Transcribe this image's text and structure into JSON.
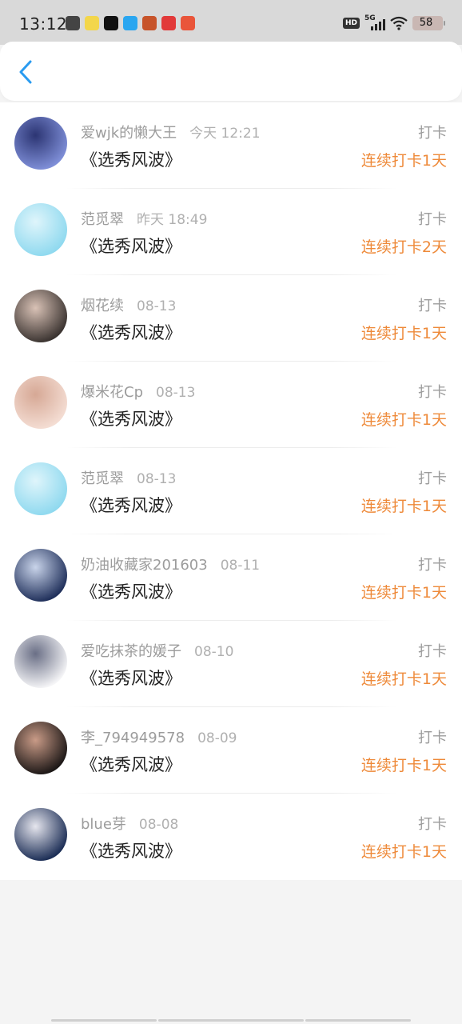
{
  "status_bar": {
    "time": "13:12",
    "network": "5G",
    "hd": "HD",
    "battery": "58",
    "notification_icons": [
      {
        "name": "app-icon-1",
        "color": "#444444"
      },
      {
        "name": "app-icon-2",
        "color": "#f3d64b"
      },
      {
        "name": "tiktok-icon",
        "color": "#111111"
      },
      {
        "name": "app-icon-4",
        "color": "#2aa6f0"
      },
      {
        "name": "app-icon-5",
        "color": "#c7542a"
      },
      {
        "name": "app-icon-6",
        "color": "#e23a3a"
      },
      {
        "name": "app-icon-7",
        "color": "#e9553a"
      }
    ]
  },
  "nav": {
    "back_icon": "chevron-left-icon",
    "accent": "#2a9bf0"
  },
  "colors": {
    "streak": "#ee8a3a",
    "meta": "#9c9c9c"
  },
  "items": [
    {
      "name": "爱wjk的懒大王",
      "time": "今天 12:21",
      "title": "《选秀风波》",
      "action": "打卡",
      "streak": "连续打卡1天",
      "avatar_colors": [
        "#7f8fd8",
        "#2c3573"
      ]
    },
    {
      "name": "范觅翠",
      "time": "昨天 18:49",
      "title": "《选秀风波》",
      "action": "打卡",
      "streak": "连续打卡2天",
      "avatar_colors": [
        "#8fd9ef",
        "#dff5fb"
      ]
    },
    {
      "name": "烟花续",
      "time": "08-13",
      "title": "《选秀风波》",
      "action": "打卡",
      "streak": "连续打卡1天",
      "avatar_colors": [
        "#3a3330",
        "#d9c2b6"
      ]
    },
    {
      "name": "爆米花Cp",
      "time": "08-13",
      "title": "《选秀风波》",
      "action": "打卡",
      "streak": "连续打卡1天",
      "avatar_colors": [
        "#f4ddd3",
        "#d6a895"
      ]
    },
    {
      "name": "范觅翠",
      "time": "08-13",
      "title": "《选秀风波》",
      "action": "打卡",
      "streak": "连续打卡1天",
      "avatar_colors": [
        "#8fd9ef",
        "#dff5fb"
      ]
    },
    {
      "name": "奶油收藏家201603",
      "time": "08-11",
      "title": "《选秀风波》",
      "action": "打卡",
      "streak": "连续打卡1天",
      "avatar_colors": [
        "#1f2f5a",
        "#c9d4ea"
      ]
    },
    {
      "name": "爱吃抹茶的媛子",
      "time": "08-10",
      "title": "《选秀风波》",
      "action": "打卡",
      "streak": "连续打卡1天",
      "avatar_colors": [
        "#f5f5f7",
        "#6a6f86"
      ]
    },
    {
      "name": "李_794949578",
      "time": "08-09",
      "title": "《选秀风波》",
      "action": "打卡",
      "streak": "连续打卡1天",
      "avatar_colors": [
        "#1c1716",
        "#c99b87"
      ]
    },
    {
      "name": "blue芽",
      "time": "08-08",
      "title": "《选秀风波》",
      "action": "打卡",
      "streak": "连续打卡1天",
      "avatar_colors": [
        "#1b2d55",
        "#e6e6ee"
      ]
    }
  ]
}
